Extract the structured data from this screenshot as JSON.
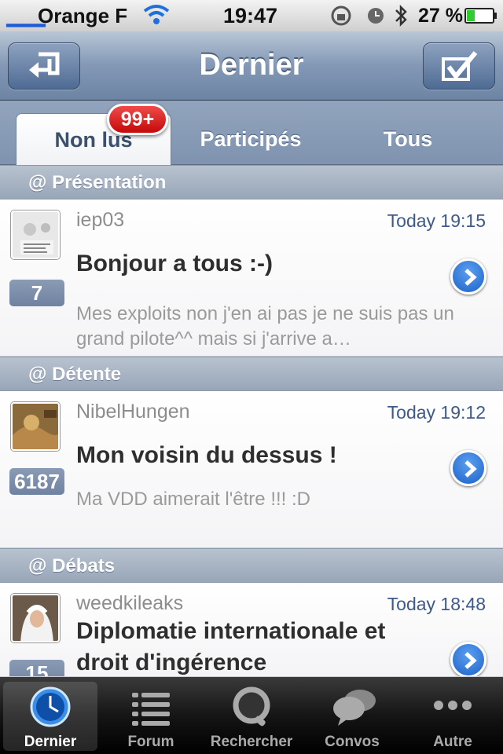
{
  "status": {
    "carrier": "Orange F",
    "time": "19:47",
    "battery": "27 %"
  },
  "navbar": {
    "title": "Dernier"
  },
  "tabs": {
    "items": [
      "Non lus",
      "Participés",
      "Tous"
    ],
    "badge": "99+"
  },
  "sections": [
    {
      "header": "@ Présentation",
      "author": "iep03",
      "date": "Today 19:15",
      "subject": "Bonjour a tous :-)",
      "preview": "Mes exploits non j'en ai pas je ne suis pas un grand pilote^^ mais si j'arrive a…",
      "count": "7"
    },
    {
      "header": "@ Détente",
      "author": "NibelHungen",
      "date": "Today 19:12",
      "subject": "Mon voisin du dessus !",
      "preview": "Ma VDD aimerait l'être !!! :D",
      "count": "6187"
    },
    {
      "header": "@ Débats",
      "author": "weedkileaks",
      "date": "Today 18:48",
      "subject": "Diplomatie internationale et droit d'ingérence",
      "preview": "",
      "count": "15"
    }
  ],
  "tabbar": {
    "items": [
      "Dernier",
      "Forum",
      "Rechercher",
      "Convos",
      "Autre"
    ]
  },
  "colors": {
    "accent": "#1d62c8",
    "badge": "#d41414",
    "nav": "#6d84a4"
  }
}
